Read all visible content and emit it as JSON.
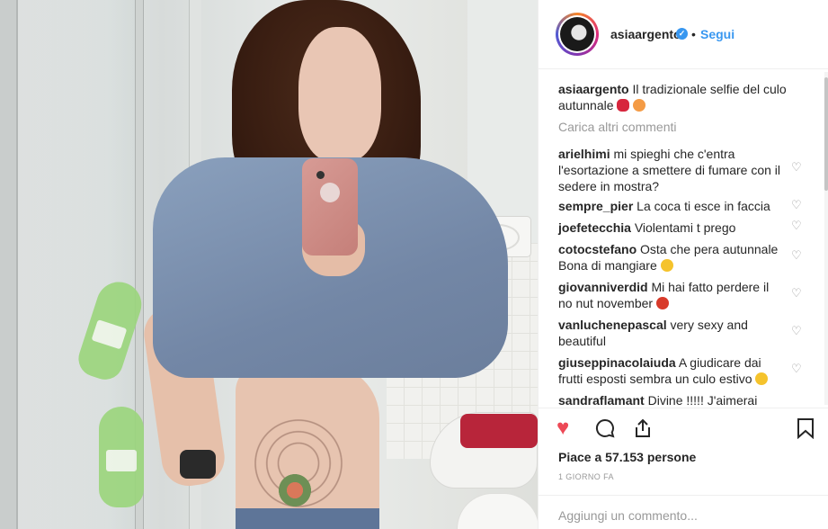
{
  "header": {
    "username": "asiaargento",
    "separator": "•",
    "follow_label": "Segui"
  },
  "caption": {
    "username": "asiaargento",
    "text": "Il tradizionale selfie del culo autunnale"
  },
  "load_more_label": "Carica altri commenti",
  "comments": [
    {
      "user": "arielhimi",
      "text": "mi spieghi che c'entra l'esortazione a smettere di fumare con il sedere in mostra?"
    },
    {
      "user": "sempre_pier",
      "text": "La coca ti esce in faccia"
    },
    {
      "user": "joefetecchia",
      "text": "Violentami t prego"
    },
    {
      "user": "cotocstefano",
      "text": "Osta che pera autunnale Bona di mangiare"
    },
    {
      "user": "giovanniverdid",
      "text": "Mi hai fatto perdere il no nut november"
    },
    {
      "user": "vanluchenepascal",
      "text": "very sexy and beautiful"
    },
    {
      "user": "giuseppinacolaiuda",
      "text": "A giudicare dai frutti esposti sembra un culo estivo"
    },
    {
      "user": "sandraflamant",
      "text": "Divine !!!!! J'aimerai"
    }
  ],
  "likes_text": "Piace a 57.153 persone",
  "time_text": "1 GIORNO FA",
  "add_comment_placeholder": "Aggiungi un commento...",
  "icons": {
    "like": "heart-icon",
    "comment": "comment-icon",
    "share": "share-icon",
    "save": "bookmark-icon",
    "verified": "verified-badge-icon",
    "comment_like": "heart-outline-icon"
  },
  "colors": {
    "accent": "#3897f0",
    "like": "#ed4956",
    "muted": "#999999",
    "text": "#262626"
  }
}
